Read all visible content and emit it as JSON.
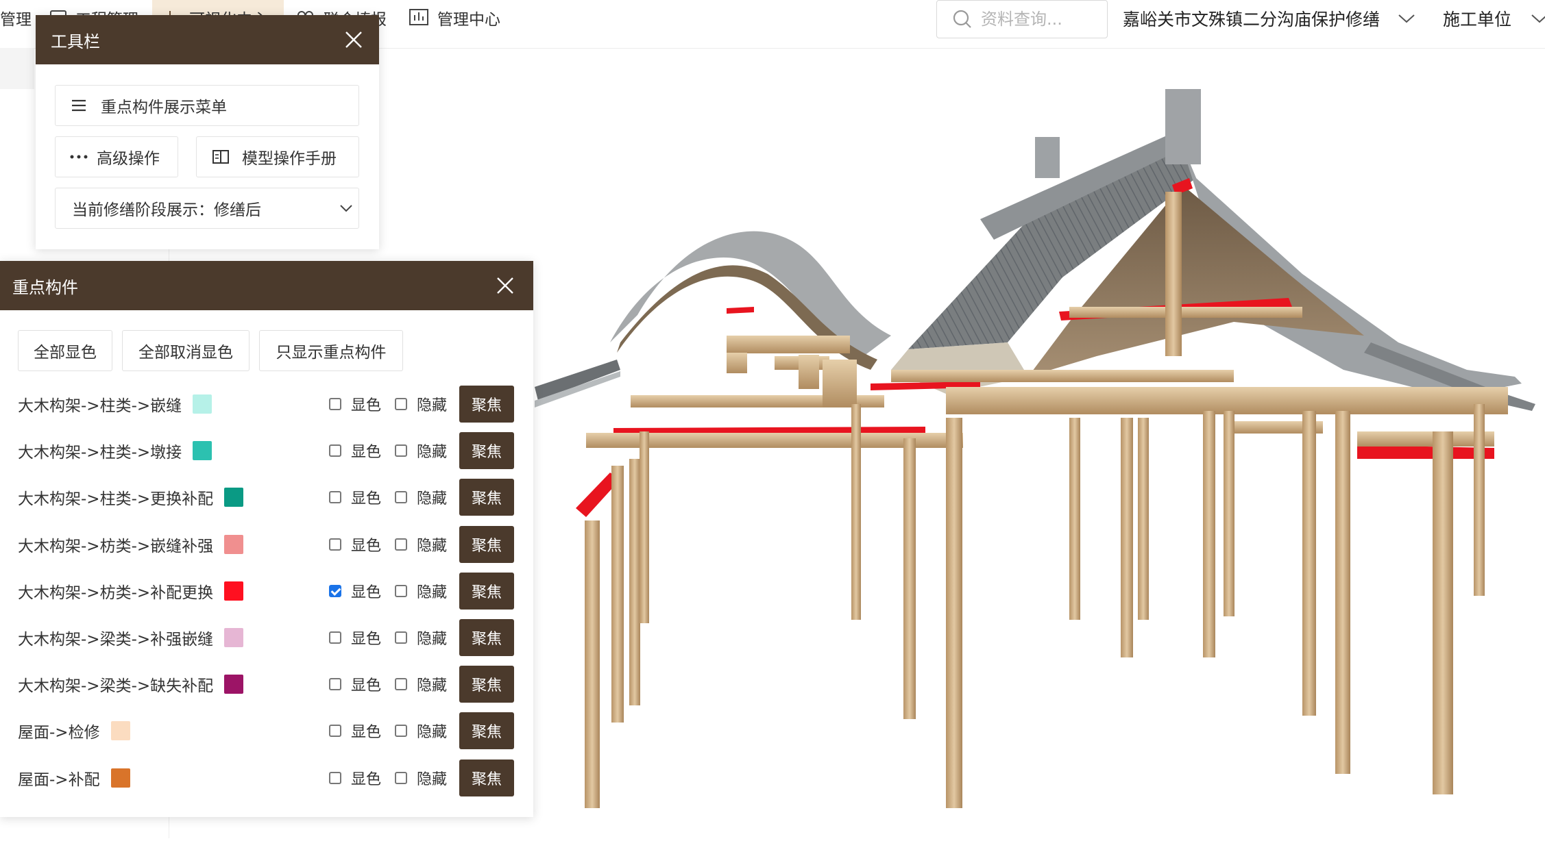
{
  "nav": {
    "items": [
      {
        "label": "管理",
        "icon": "",
        "active": false
      },
      {
        "label": "工程管理",
        "icon": "document-icon",
        "active": false
      },
      {
        "label": "可视化中心",
        "icon": "model-icon",
        "active": true
      },
      {
        "label": "联合填报",
        "icon": "users-icon",
        "active": false
      },
      {
        "label": "管理中心",
        "icon": "bar-chart-icon",
        "active": false
      }
    ],
    "search_placeholder": "资料查询...",
    "project": "嘉峪关市文殊镇二分沟庙保护修缮",
    "unit": "施工单位"
  },
  "toolbar": {
    "title": "工具栏",
    "menu_label": "重点构件展示菜单",
    "advanced_label": "高级操作",
    "manual_label": "模型操作手册",
    "stage_label": "当前修缮阶段展示：修缮后"
  },
  "key_components": {
    "title": "重点构件",
    "btn_show_all": "全部显色",
    "btn_cancel_all": "全部取消显色",
    "btn_only_key": "只显示重点构件",
    "show_label": "显色",
    "hide_label": "隐藏",
    "focus_label": "聚焦",
    "items": [
      {
        "label": "大木构架->柱类->嵌缝",
        "color": "#b6f1e8",
        "show": false,
        "hide": false
      },
      {
        "label": "大木构架->柱类->墩接",
        "color": "#2cc1b0",
        "show": false,
        "hide": false
      },
      {
        "label": "大木构架->柱类->更换补配",
        "color": "#0a9a84",
        "show": false,
        "hide": false
      },
      {
        "label": "大木构架->枋类->嵌缝补强",
        "color": "#f08f8f",
        "show": false,
        "hide": false
      },
      {
        "label": "大木构架->枋类->补配更换",
        "color": "#ff1020",
        "show": true,
        "hide": false
      },
      {
        "label": "大木构架->梁类->补强嵌缝",
        "color": "#e6b6d4",
        "show": false,
        "hide": false
      },
      {
        "label": "大木构架->梁类->缺失补配",
        "color": "#9c1466",
        "show": false,
        "hide": false
      },
      {
        "label": "屋面->检修",
        "color": "#fbdcc0",
        "show": false,
        "hide": false
      },
      {
        "label": "屋面->补配",
        "color": "#d9742a",
        "show": false,
        "hide": false
      }
    ]
  }
}
